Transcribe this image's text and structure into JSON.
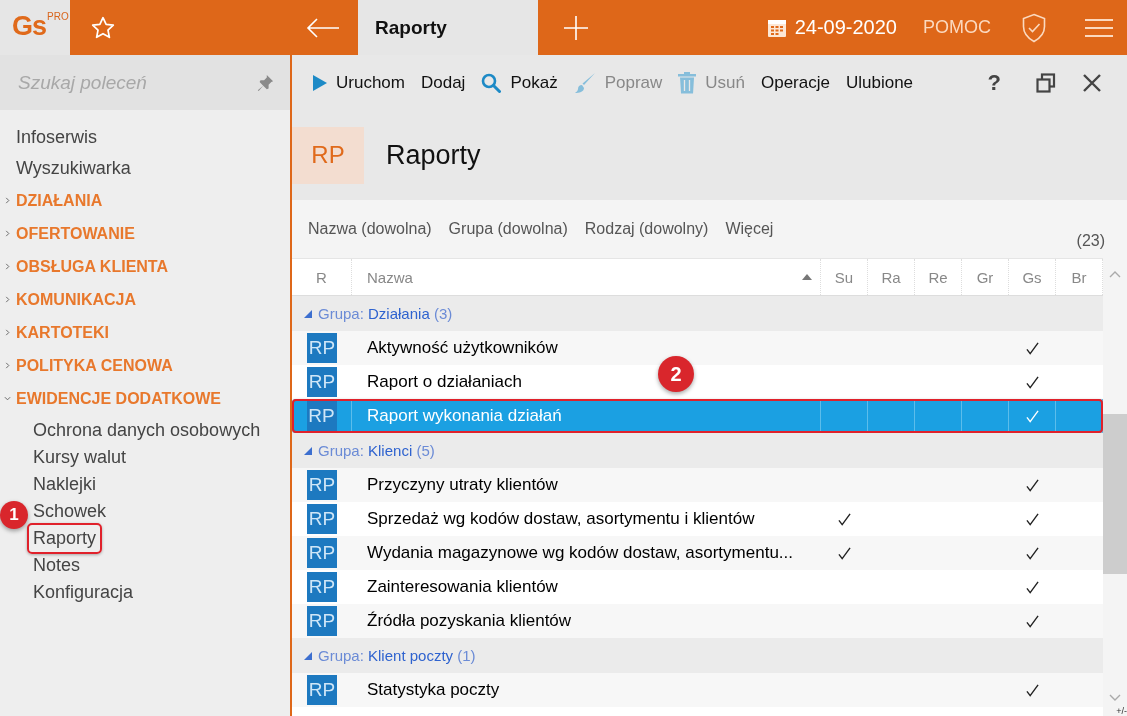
{
  "logo": {
    "text": "Gs",
    "sup": "PRO"
  },
  "topbar": {
    "active_tab": "Raporty",
    "date": "24-09-2020",
    "help": "POMOC"
  },
  "sidebar": {
    "search": {
      "placeholder": "Szukaj poleceń"
    },
    "items": [
      {
        "kind": "link",
        "label": "Infoserwis"
      },
      {
        "kind": "link",
        "label": "Wyszukiwarka"
      },
      {
        "kind": "section",
        "label": "DZIAŁANIA",
        "expanded": false
      },
      {
        "kind": "section",
        "label": "OFERTOWANIE",
        "expanded": false
      },
      {
        "kind": "section",
        "label": "OBSŁUGA KLIENTA",
        "expanded": false
      },
      {
        "kind": "section",
        "label": "KOMUNIKACJA",
        "expanded": false
      },
      {
        "kind": "section",
        "label": "KARTOTEKI",
        "expanded": false
      },
      {
        "kind": "section",
        "label": "POLITYKA CENOWA",
        "expanded": false
      },
      {
        "kind": "section",
        "label": "EWIDENCJE DODATKOWE",
        "expanded": true,
        "children": [
          {
            "label": "Ochrona danych osobowych",
            "highlighted": false
          },
          {
            "label": "Kursy walut",
            "highlighted": false
          },
          {
            "label": "Naklejki",
            "highlighted": false
          },
          {
            "label": "Schowek",
            "highlighted": false
          },
          {
            "label": "Raporty",
            "highlighted": true
          },
          {
            "label": "Notes",
            "highlighted": false
          },
          {
            "label": "Konfiguracja",
            "highlighted": false
          }
        ]
      }
    ]
  },
  "toolbar": {
    "buttons": [
      {
        "kind": "run",
        "label": "Uruchom",
        "disabled": false
      },
      {
        "kind": "text",
        "label": "Dodaj",
        "disabled": false
      },
      {
        "kind": "show",
        "label": "Pokaż",
        "disabled": false
      },
      {
        "kind": "edit",
        "label": "Popraw",
        "disabled": true
      },
      {
        "kind": "delete",
        "label": "Usuń",
        "disabled": true
      },
      {
        "kind": "text",
        "label": "Operacje",
        "disabled": false
      },
      {
        "kind": "text",
        "label": "Ulubione",
        "disabled": false
      }
    ],
    "help": "?"
  },
  "header": {
    "badge": "RP",
    "title": "Raporty"
  },
  "filters": [
    "Nazwa (dowolna)",
    "Grupa (dowolna)",
    "Rodzaj (dowolny)",
    "Więcej"
  ],
  "count": "(23)",
  "table": {
    "columns": [
      "R",
      "Nazwa",
      "Su",
      "Ra",
      "Re",
      "Gr",
      "Gs",
      "Br"
    ],
    "groups": [
      {
        "prefix": "Grupa:",
        "name": "Działania",
        "count": "(3)",
        "expanded": true,
        "rows": [
          {
            "icon": "RP",
            "name": "Aktywność użytkowników",
            "checks": [
              false,
              false,
              false,
              false,
              true,
              false
            ],
            "selected": false
          },
          {
            "icon": "RP",
            "name": "Raport o działaniach",
            "checks": [
              false,
              false,
              false,
              false,
              true,
              false
            ],
            "selected": false
          },
          {
            "icon": "RP",
            "name": "Raport wykonania działań",
            "checks": [
              false,
              false,
              false,
              false,
              true,
              false
            ],
            "selected": true
          }
        ]
      },
      {
        "prefix": "Grupa:",
        "name": "Klienci",
        "count": "(5)",
        "expanded": true,
        "rows": [
          {
            "icon": "RP",
            "name": "Przyczyny utraty klientów",
            "checks": [
              false,
              false,
              false,
              false,
              true,
              false
            ],
            "selected": false
          },
          {
            "icon": "RP",
            "name": "Sprzedaż wg kodów dostaw, asortymentu i klientów",
            "checks": [
              true,
              false,
              false,
              false,
              true,
              false
            ],
            "selected": false
          },
          {
            "icon": "RP",
            "name": "Wydania magazynowe wg kodów dostaw, asortymentu...",
            "checks": [
              true,
              false,
              false,
              false,
              true,
              false
            ],
            "selected": false
          },
          {
            "icon": "RP",
            "name": "Zainteresowania klientów",
            "checks": [
              false,
              false,
              false,
              false,
              true,
              false
            ],
            "selected": false
          },
          {
            "icon": "RP",
            "name": "Źródła pozyskania klientów",
            "checks": [
              false,
              false,
              false,
              false,
              true,
              false
            ],
            "selected": false
          }
        ]
      },
      {
        "prefix": "Grupa:",
        "name": "Klient poczty",
        "count": "(1)",
        "expanded": true,
        "rows": [
          {
            "icon": "RP",
            "name": "Statystyka poczty",
            "checks": [
              false,
              false,
              false,
              false,
              true,
              false
            ],
            "selected": false
          }
        ]
      }
    ],
    "corner_label": "+/-"
  },
  "annotations": [
    {
      "label": "1"
    },
    {
      "label": "2"
    }
  ]
}
